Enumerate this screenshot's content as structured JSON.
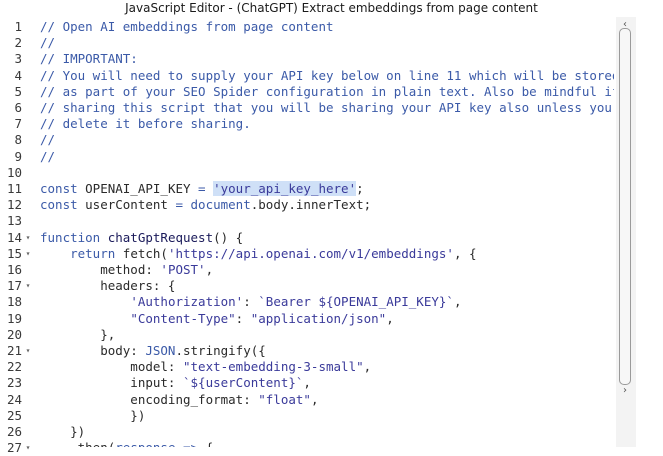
{
  "window": {
    "title": "JavaScript Editor - (ChatGPT) Extract embeddings from page content"
  },
  "editor": {
    "lines": [
      {
        "n": "1",
        "fold": false,
        "segs": [
          {
            "c": "cmt",
            "t": "// Open AI embeddings from page content"
          }
        ]
      },
      {
        "n": "2",
        "fold": false,
        "segs": [
          {
            "c": "cmt",
            "t": "//"
          }
        ]
      },
      {
        "n": "3",
        "fold": false,
        "segs": [
          {
            "c": "cmt",
            "t": "// IMPORTANT:"
          }
        ]
      },
      {
        "n": "4",
        "fold": false,
        "segs": [
          {
            "c": "cmt",
            "t": "// You will need to supply your API key below on line 11 which will be stored"
          }
        ]
      },
      {
        "n": "5",
        "fold": false,
        "segs": [
          {
            "c": "cmt",
            "t": "// as part of your SEO Spider configuration in plain text. Also be mindful if"
          }
        ]
      },
      {
        "n": "6",
        "fold": false,
        "segs": [
          {
            "c": "cmt",
            "t": "// sharing this script that you will be sharing your API key also unless you"
          }
        ]
      },
      {
        "n": "7",
        "fold": false,
        "segs": [
          {
            "c": "cmt",
            "t": "// delete it before sharing."
          }
        ]
      },
      {
        "n": "8",
        "fold": false,
        "segs": [
          {
            "c": "cmt",
            "t": "//"
          }
        ]
      },
      {
        "n": "9",
        "fold": false,
        "segs": [
          {
            "c": "cmt",
            "t": "//"
          }
        ]
      },
      {
        "n": "10",
        "fold": false,
        "segs": []
      },
      {
        "n": "11",
        "fold": false,
        "segs": [
          {
            "c": "kw",
            "t": "const "
          },
          {
            "c": "",
            "t": "OPENAI_API_KEY "
          },
          {
            "c": "kw",
            "t": "= "
          },
          {
            "c": "str sel",
            "t": "'your_api_key_here'"
          },
          {
            "c": "",
            "t": ";"
          }
        ]
      },
      {
        "n": "12",
        "fold": false,
        "segs": [
          {
            "c": "kw",
            "t": "const "
          },
          {
            "c": "",
            "t": "userContent "
          },
          {
            "c": "kw",
            "t": "= "
          },
          {
            "c": "obj",
            "t": "document"
          },
          {
            "c": "",
            "t": ".body.innerText;"
          }
        ]
      },
      {
        "n": "13",
        "fold": false,
        "segs": []
      },
      {
        "n": "14",
        "fold": true,
        "segs": [
          {
            "c": "kw",
            "t": "function "
          },
          {
            "c": "fn",
            "t": "chatGptRequest"
          },
          {
            "c": "",
            "t": "() {"
          }
        ]
      },
      {
        "n": "15",
        "fold": true,
        "segs": [
          {
            "c": "",
            "t": "    "
          },
          {
            "c": "kw",
            "t": "return "
          },
          {
            "c": "",
            "t": "fetch("
          },
          {
            "c": "str",
            "t": "'https://api.openai.com/v1/embeddings'"
          },
          {
            "c": "",
            "t": ", {"
          }
        ]
      },
      {
        "n": "16",
        "fold": false,
        "segs": [
          {
            "c": "",
            "t": "        method: "
          },
          {
            "c": "str",
            "t": "'POST'"
          },
          {
            "c": "",
            "t": ","
          }
        ]
      },
      {
        "n": "17",
        "fold": true,
        "segs": [
          {
            "c": "",
            "t": "        headers: {"
          }
        ]
      },
      {
        "n": "18",
        "fold": false,
        "segs": [
          {
            "c": "",
            "t": "            "
          },
          {
            "c": "str",
            "t": "'Authorization'"
          },
          {
            "c": "",
            "t": ": "
          },
          {
            "c": "str",
            "t": "`Bearer ${OPENAI_API_KEY}`"
          },
          {
            "c": "",
            "t": ","
          }
        ]
      },
      {
        "n": "19",
        "fold": false,
        "segs": [
          {
            "c": "",
            "t": "            "
          },
          {
            "c": "str",
            "t": "\"Content-Type\""
          },
          {
            "c": "",
            "t": ": "
          },
          {
            "c": "str",
            "t": "\"application/json\""
          },
          {
            "c": "",
            "t": ","
          }
        ]
      },
      {
        "n": "20",
        "fold": false,
        "segs": [
          {
            "c": "",
            "t": "        },"
          }
        ]
      },
      {
        "n": "21",
        "fold": true,
        "segs": [
          {
            "c": "",
            "t": "        body: "
          },
          {
            "c": "obj",
            "t": "JSON"
          },
          {
            "c": "",
            "t": ".stringify({"
          }
        ]
      },
      {
        "n": "22",
        "fold": false,
        "segs": [
          {
            "c": "",
            "t": "            model: "
          },
          {
            "c": "str",
            "t": "\"text-embedding-3-small\""
          },
          {
            "c": "",
            "t": ","
          }
        ]
      },
      {
        "n": "23",
        "fold": false,
        "segs": [
          {
            "c": "",
            "t": "            input: "
          },
          {
            "c": "str",
            "t": "`${userContent}`"
          },
          {
            "c": "",
            "t": ","
          }
        ]
      },
      {
        "n": "24",
        "fold": false,
        "segs": [
          {
            "c": "",
            "t": "            encoding_format: "
          },
          {
            "c": "str",
            "t": "\"float\""
          },
          {
            "c": "",
            "t": ","
          }
        ]
      },
      {
        "n": "25",
        "fold": false,
        "segs": [
          {
            "c": "",
            "t": "            })"
          }
        ]
      },
      {
        "n": "26",
        "fold": false,
        "segs": [
          {
            "c": "",
            "t": "    })"
          }
        ]
      },
      {
        "n": "27",
        "fold": true,
        "segs": [
          {
            "c": "",
            "t": "    .then("
          },
          {
            "c": "kw",
            "t": "response "
          },
          {
            "c": "kw",
            "t": "=> "
          },
          {
            "c": "",
            "t": "{"
          }
        ]
      }
    ]
  },
  "scrollbar": {
    "up_arrow": "‹",
    "down_arrow": "›"
  }
}
